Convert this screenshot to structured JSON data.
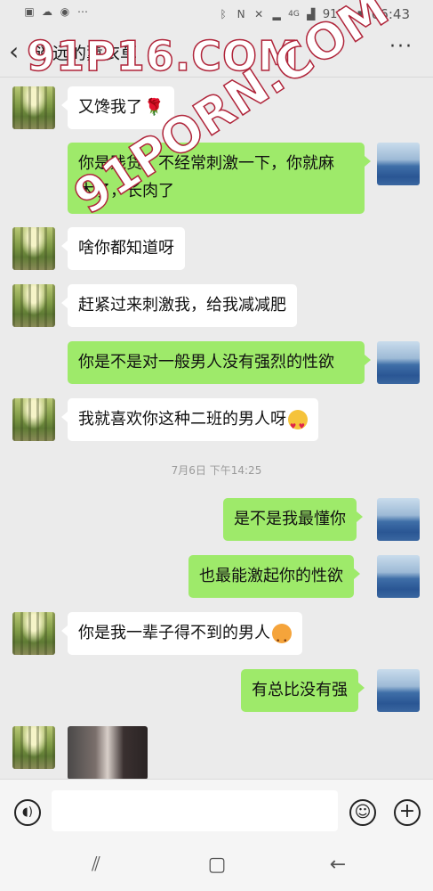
{
  "status_bar": {
    "battery": "91%",
    "time": "06:43",
    "signal": "4G"
  },
  "header": {
    "title": "遥远的薰衣草",
    "back_icon": "chevron-left-icon",
    "more_icon": "more-dots-icon"
  },
  "messages": [
    {
      "side": "in",
      "text": "又馋我了",
      "emoji": "rose"
    },
    {
      "side": "out",
      "line1": "你是贱货，不经常刺激一下，你就麻",
      "line2": "木了，长肉了"
    },
    {
      "side": "in",
      "text": "啥你都知道呀"
    },
    {
      "side": "in",
      "text": "赶紧过来刺激我，给我减减肥"
    },
    {
      "side": "out",
      "text": "你是不是对一般男人没有强烈的性欲"
    },
    {
      "side": "in",
      "text": "我就喜欢你这种二班的男人呀",
      "emoji": "heart-eyes"
    },
    {
      "side": "out",
      "text": "是不是我最懂你"
    },
    {
      "side": "out",
      "text": "也最能激起你的性欲"
    },
    {
      "side": "in",
      "text": "你是我一辈子得不到的男人",
      "emoji": "blush"
    },
    {
      "side": "out",
      "text": "有总比没有强"
    },
    {
      "side": "in",
      "type": "image"
    }
  ],
  "timestamp": "7月6日 下午14:25",
  "watermarks": [
    "91P16.COM",
    "91PORN.COM"
  ],
  "colors": {
    "background": "#ebebeb",
    "outgoing_bubble": "#9eea6a",
    "incoming_bubble": "#ffffff"
  }
}
